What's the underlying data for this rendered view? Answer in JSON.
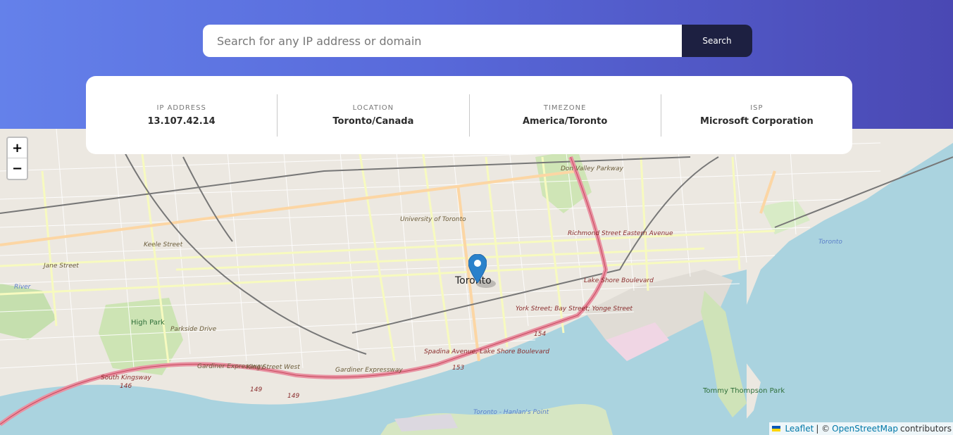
{
  "search": {
    "placeholder": "Search for any IP address or domain",
    "value": "",
    "button_label": "Search"
  },
  "info": {
    "ip_label": "IP ADDRESS",
    "ip_value": "13.107.42.14",
    "location_label": "LOCATION",
    "location_value": "Toronto/Canada",
    "timezone_label": "TIMEZONE",
    "timezone_value": "America/Toronto",
    "isp_label": "ISP",
    "isp_value": "Microsoft Corporation"
  },
  "map": {
    "city": "Toronto",
    "zoom_in": "+",
    "zoom_out": "−",
    "marker_icon": "map-pin-icon",
    "labels": {
      "university": "University of Toronto",
      "richmond": "Richmond Street Eastern Avenue",
      "lake_shore": "Lake Shore Boulevard",
      "york": "York Street; Bay Street; Yonge Street",
      "york_num": "154",
      "spadina": "Spadina Avenue; Lake Shore Boulevard",
      "spadina_num": "153",
      "high_park": "High Park",
      "parkside": "Parkside Drive",
      "keele": "Keele Street",
      "jane": "Jane Street",
      "river": "River",
      "south_kingsway": "South Kingsway",
      "south_kingsway_num": "146",
      "gardiner": "Gardiner Expressway",
      "gardiner2": "Gardiner Expressway",
      "king": "King Street West",
      "num149a": "149",
      "num149b": "149",
      "don_valley": "Don Valley Parkway",
      "tommy": "Tommy Thompson Park",
      "toronto_water": "Toronto",
      "hanlan": "Toronto - Hanlan's Point"
    },
    "attribution": {
      "leaflet": "Leaflet",
      "sep": "| ©",
      "osm": "OpenStreetMap",
      "contributors": "contributors"
    }
  },
  "colors": {
    "header_gradient_start": "#6481ea",
    "header_gradient_end": "#4a48b3",
    "search_button": "#1d2041",
    "marker": "#2a81cb",
    "water": "#aad3df"
  }
}
